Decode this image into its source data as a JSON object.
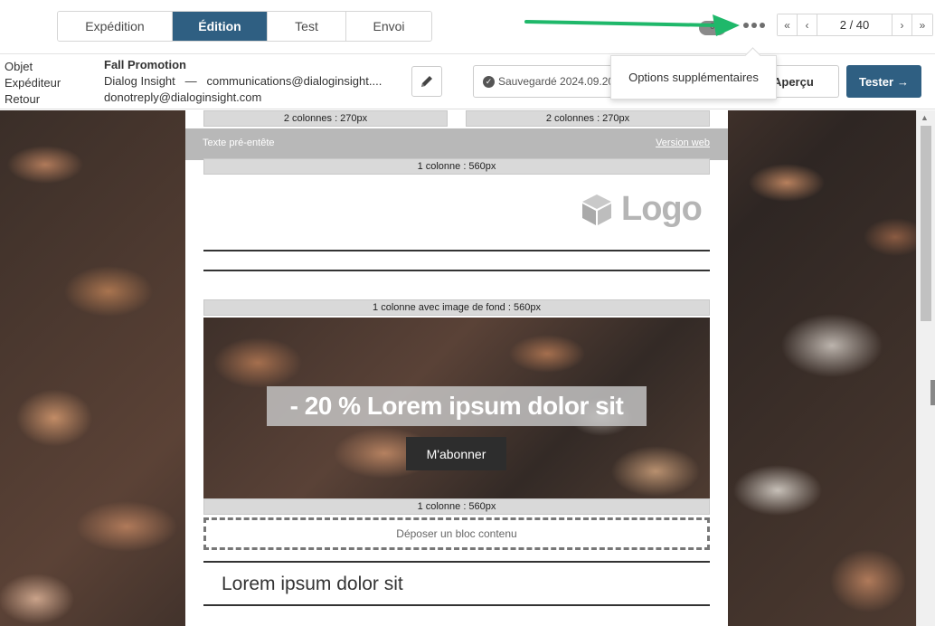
{
  "tabs": [
    {
      "label": "Expédition",
      "active": false
    },
    {
      "label": "Édition",
      "active": true
    },
    {
      "label": "Test",
      "active": false
    },
    {
      "label": "Envoi",
      "active": false
    }
  ],
  "toolbar": {
    "toggle_label": "0",
    "more_options_icon": "ellipsis-icon",
    "pager": {
      "first": "«",
      "prev": "‹",
      "current": "2 / 40",
      "next": "›",
      "last": "»"
    }
  },
  "tooltip": {
    "text": "Options supplémentaires"
  },
  "message": {
    "labels": {
      "subject": "Objet",
      "sender": "Expéditeur",
      "reply": "Retour"
    },
    "subject": "Fall Promotion",
    "sender_name": "Dialog Insight",
    "separator": "—",
    "sender_email": "communications@dialoginsight....",
    "reply_email": "donotreply@dialoginsight.com"
  },
  "actions": {
    "saved_label": "Sauvegardé 2024.09.20",
    "preview_label": "Aperçu",
    "test_label": "Tester",
    "test_arrow": "→"
  },
  "email": {
    "col2_left": "2 colonnes : 270px",
    "col2_right": "2 colonnes : 270px",
    "preheader_text": "Texte pré-entête",
    "web_version": "Version web",
    "col1_label": "1 colonne : 560px",
    "logo_text": "Logo",
    "bg_image_label": "1 colonne avec image de fond : 560px",
    "hero_title": "- 20 % Lorem ipsum dolor sit",
    "hero_button": "M'abonner",
    "col1_label_2": "1 colonne : 560px",
    "drop_zone": "Déposer un bloc contenu",
    "section_title": "Lorem ipsum dolor sit"
  },
  "colors": {
    "primary": "#2f5f82",
    "arrow": "#1fb86a"
  }
}
